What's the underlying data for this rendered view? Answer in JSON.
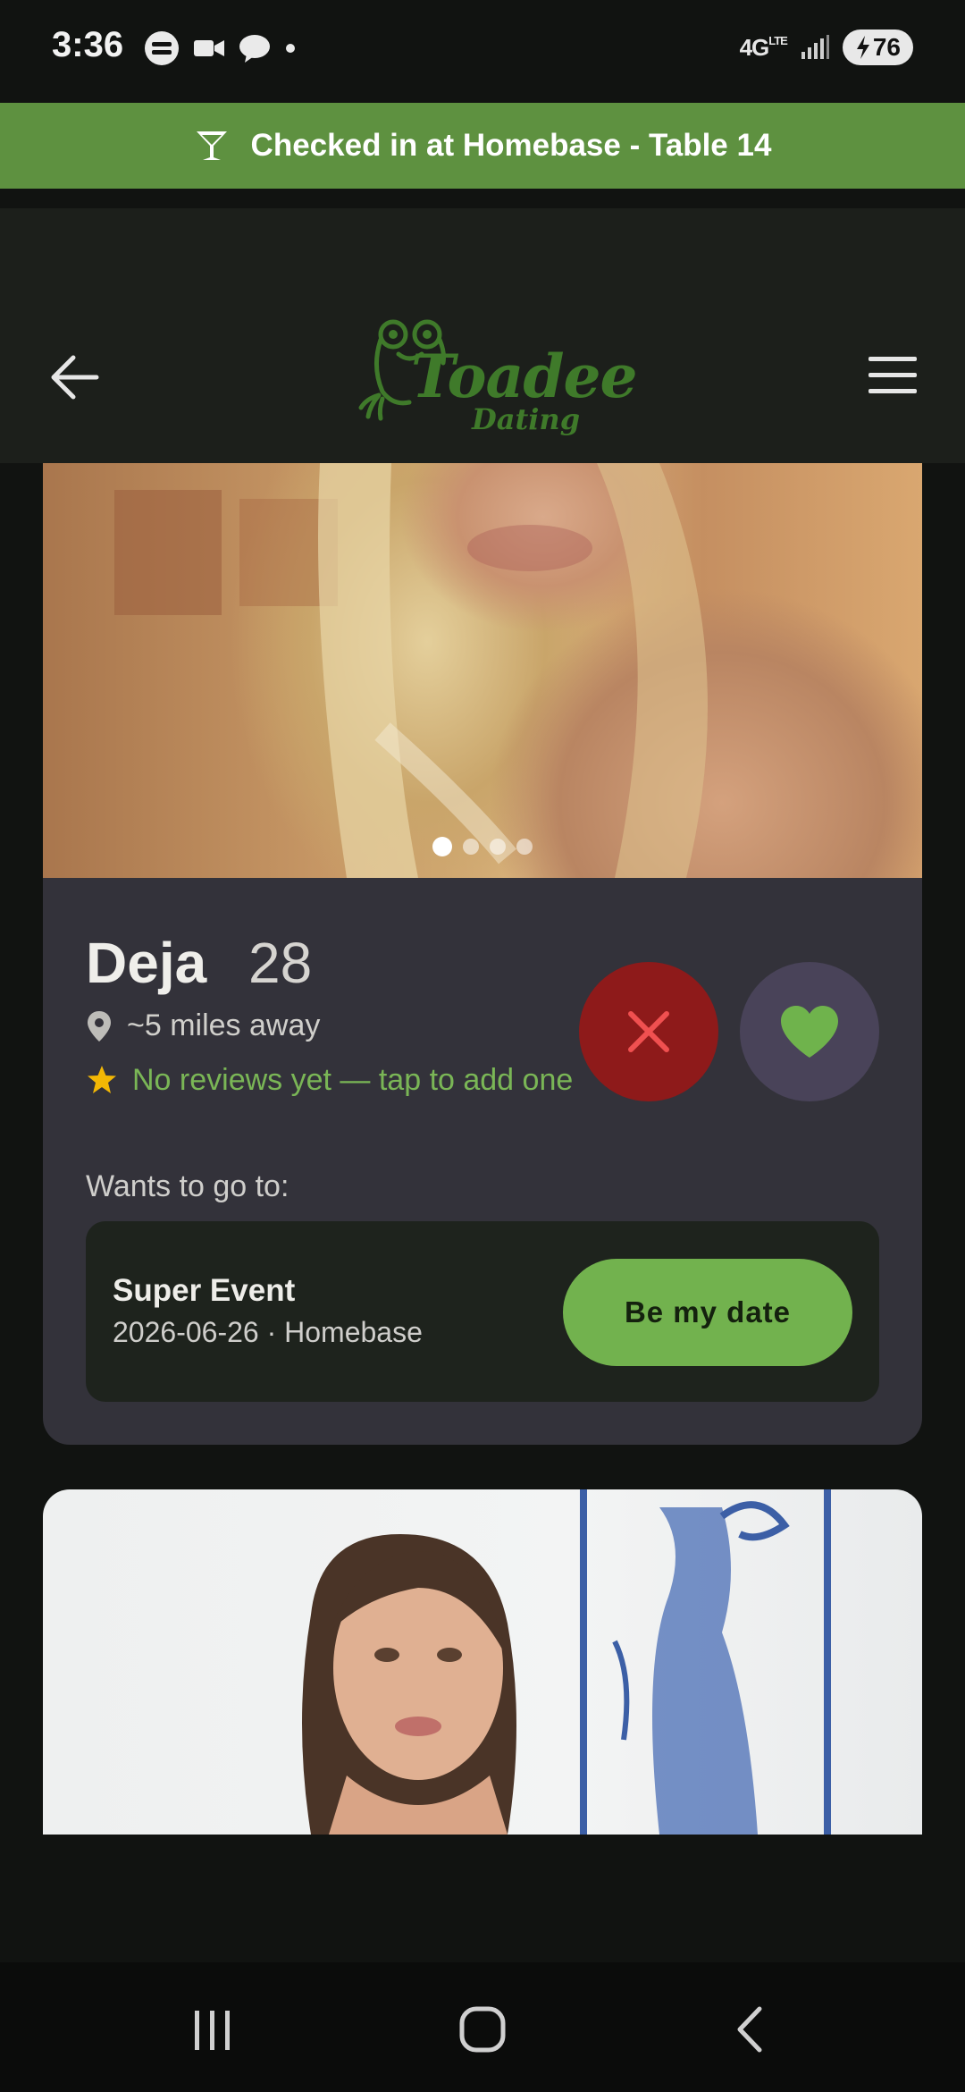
{
  "status_bar": {
    "time": "3:36",
    "network": "4G",
    "network_suffix": "LTE",
    "battery": "76"
  },
  "checkin_banner": {
    "icon": "cocktail-icon",
    "text": "Checked in at Homebase - Table 14"
  },
  "header": {
    "logo_primary": "Toadee",
    "logo_secondary": "Dating",
    "brand_color": "#3f7a2a"
  },
  "profile": {
    "name": "Deja",
    "age": "28",
    "distance": "~5 miles away",
    "reviews": "No reviews yet — tap to add one",
    "photo_count": 4,
    "active_photo": 1,
    "wants_label": "Wants to go to:",
    "event": {
      "title": "Super Event",
      "details": "2026-06-26 · Homebase",
      "button": "Be my date"
    }
  },
  "colors": {
    "accent_green": "#72b24e",
    "banner_green": "#5e9140",
    "reject_red": "#8e1a1a",
    "like_bg": "#494359",
    "card_bg": "#33323a"
  }
}
